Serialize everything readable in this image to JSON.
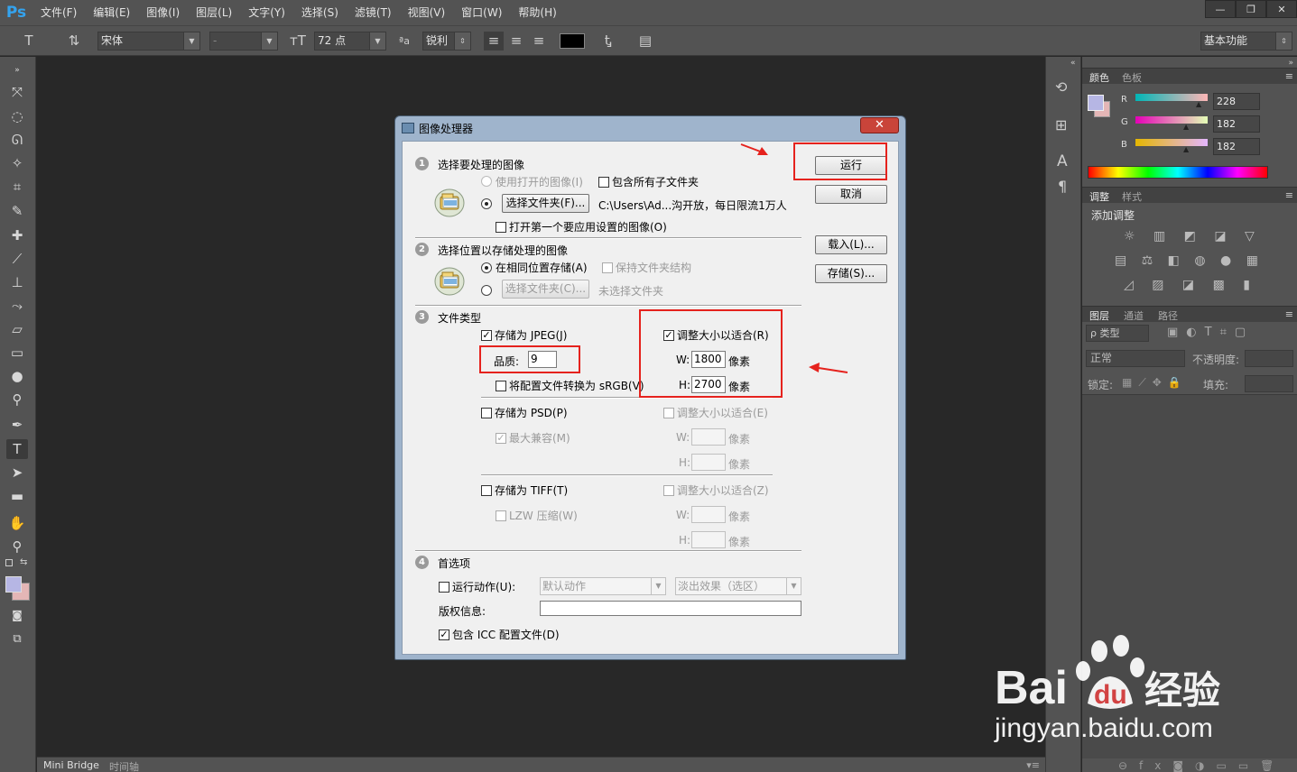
{
  "app": {
    "logo": "Ps",
    "menu": [
      "文件(F)",
      "编辑(E)",
      "图像(I)",
      "图层(L)",
      "文字(Y)",
      "选择(S)",
      "滤镜(T)",
      "视图(V)",
      "窗口(W)",
      "帮助(H)"
    ],
    "window_controls": [
      "—",
      "❐",
      "✕"
    ]
  },
  "options_bar": {
    "font_family": "宋体",
    "font_style": "-",
    "font_size": "72 点",
    "antialias": "锐利",
    "workspace": "基本功能"
  },
  "bottom_tabs": [
    "Mini Bridge",
    "时间轴"
  ],
  "panels": {
    "color": {
      "tabs": [
        "颜色",
        "色板"
      ],
      "r_label": "R",
      "r_value": "228",
      "g_label": "G",
      "g_value": "182",
      "b_label": "B",
      "b_value": "182"
    },
    "adjustments": {
      "tabs": [
        "调整",
        "样式"
      ],
      "title": "添加调整"
    },
    "layers": {
      "tabs": [
        "图层",
        "通道",
        "路径"
      ],
      "filter": "ρ 类型",
      "blend_mode": "正常",
      "opacity_label": "不透明度:",
      "lock_label": "锁定:",
      "fill_label": "填充:"
    }
  },
  "dialog": {
    "title": "图像处理器",
    "close": "✕",
    "section1": {
      "num": "1",
      "title": "选择要处理的图像",
      "use_open": "使用打开的图像(I)",
      "include_subfolders": "包含所有子文件夹",
      "choose_folder_btn": "选择文件夹(F)...",
      "folder_path": "C:\\Users\\Ad...沟开放，每日限流1万人",
      "open_first": "打开第一个要应用设置的图像(O)"
    },
    "section2": {
      "num": "2",
      "title": "选择位置以存储处理的图像",
      "same_location": "在相同位置存储(A)",
      "keep_structure": "保持文件夹结构",
      "choose_folder_btn": "选择文件夹(C)...",
      "no_folder": "未选择文件夹"
    },
    "section3": {
      "num": "3",
      "title": "文件类型",
      "save_jpeg": "存储为 JPEG(J)",
      "quality_label": "品质:",
      "quality_value": "9",
      "convert_srgb": "将配置文件转换为 sRGB(V)",
      "resize_jpeg": "调整大小以适合(R)",
      "w_label": "W:",
      "h_label": "H:",
      "w_value": "1800",
      "h_value": "2700",
      "px": "像素",
      "save_psd": "存储为 PSD(P)",
      "maximize_compat": "最大兼容(M)",
      "resize_psd": "调整大小以适合(E)",
      "save_tiff": "存储为 TIFF(T)",
      "lzw": "LZW 压缩(W)",
      "resize_tiff": "调整大小以适合(Z)"
    },
    "section4": {
      "num": "4",
      "title": "首选项",
      "run_action": "运行动作(U):",
      "action_set": "默认动作",
      "action_name": "淡出效果（选区）",
      "copyright_label": "版权信息:",
      "include_icc": "包含 ICC 配置文件(D)"
    },
    "buttons": {
      "run": "运行",
      "cancel": "取消",
      "load": "载入(L)...",
      "save": "存储(S)..."
    }
  },
  "watermark": {
    "brand": "Bai",
    "brand_suffix": "du",
    "product": "经验",
    "url": "jingyan.baidu.com"
  }
}
